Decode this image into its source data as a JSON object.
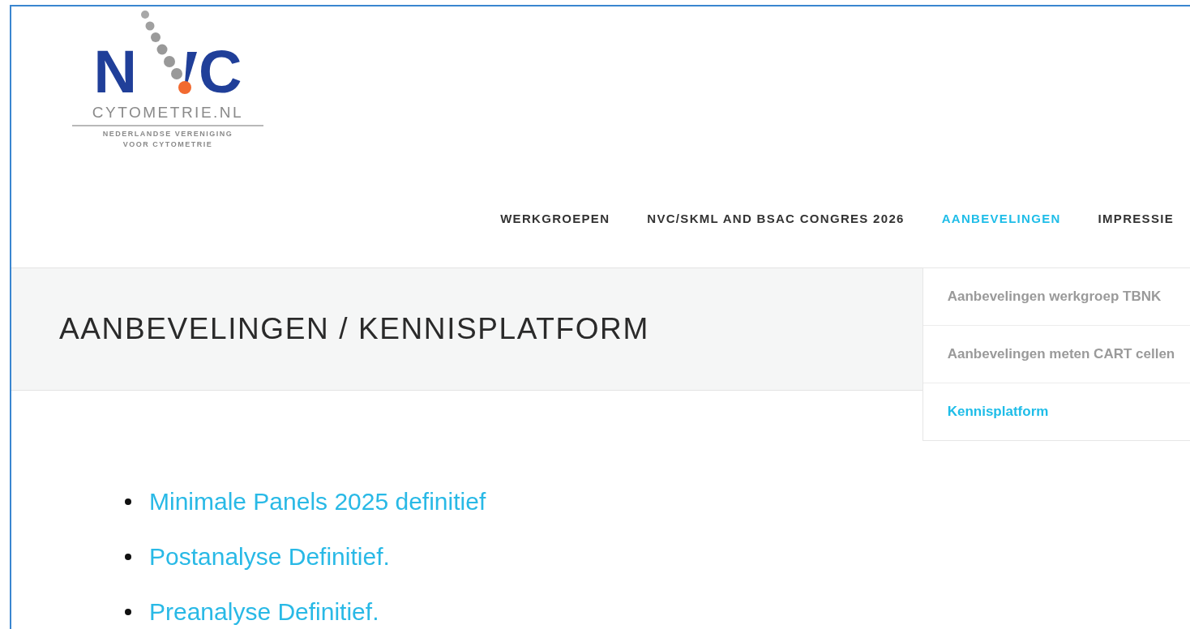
{
  "logo": {
    "letter_left": "N",
    "letter_right": "C",
    "domain": "CYTOMETRIE.NL",
    "tagline_1": "NEDERLANDSE VERENIGING",
    "tagline_2": "VOOR CYTOMETRIE"
  },
  "nav": [
    {
      "label": "WERKGROEPEN",
      "selected": false
    },
    {
      "label": "NVC/SKML AND BSAC CONGRES 2026",
      "selected": false
    },
    {
      "label": "AANBEVELINGEN",
      "selected": true,
      "submenu": [
        {
          "label": "Aanbevelingen werkgroep TBNK",
          "selected": false
        },
        {
          "label": "Aanbevelingen meten CART cellen",
          "selected": false
        },
        {
          "label": "Kennisplatform",
          "selected": true
        }
      ]
    },
    {
      "label": "IMPRESSIE",
      "selected": false
    }
  ],
  "page_title": "AANBEVELINGEN / KENNISPLATFORM",
  "links": [
    "Minimale Panels 2025 definitief",
    "Postanalyse Definitief.",
    "Preanalyse Definitief."
  ]
}
